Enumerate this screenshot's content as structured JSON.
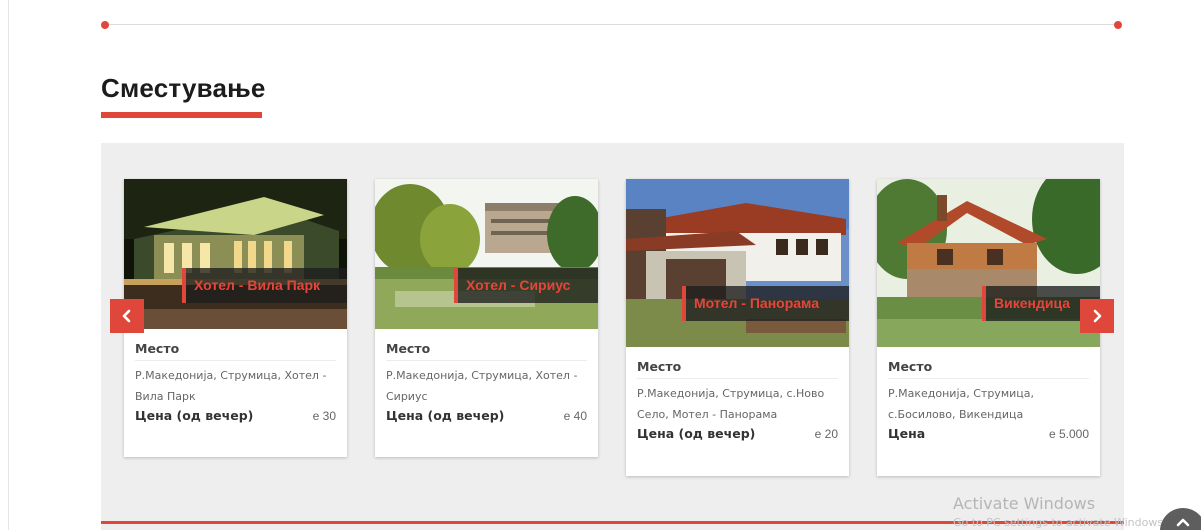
{
  "section": {
    "title": "Сместување"
  },
  "carousel": {
    "prev_icon": "chevron-left-icon",
    "next_icon": "chevron-right-icon",
    "cards": [
      {
        "caption": "Хотел - Вила Парк",
        "place_label": "Место",
        "place": "Р.Македонија, Струмица, Хотел - Вила Парк",
        "price_label": "Цена (од вечер)",
        "price": "е 30"
      },
      {
        "caption": "Хотел - Сириус",
        "place_label": "Место",
        "place": "Р.Македонија, Струмица, Хотел - Сириус",
        "price_label": "Цена (од вечер)",
        "price": "е 40"
      },
      {
        "caption": "Мотел - Панорама",
        "place_label": "Место",
        "place": "Р.Македонија, Струмица, с.Ново Село, Мотел - Панорама",
        "price_label": "Цена (од вечер)",
        "price": "е 20"
      },
      {
        "caption": "Викендица",
        "place_label": "Место",
        "place": "Р.Македонија, Струмица, с.Босилово, Викендица",
        "price_label": "Цена",
        "price": "е 5.000"
      }
    ]
  },
  "watermark": {
    "title": "Activate Windows",
    "subtitle": "Go to PC settings to activate Windows."
  },
  "colors": {
    "accent": "#e0473b",
    "panel": "#eeeeee"
  },
  "scroll_top": {
    "icon": "chevron-up-icon"
  }
}
